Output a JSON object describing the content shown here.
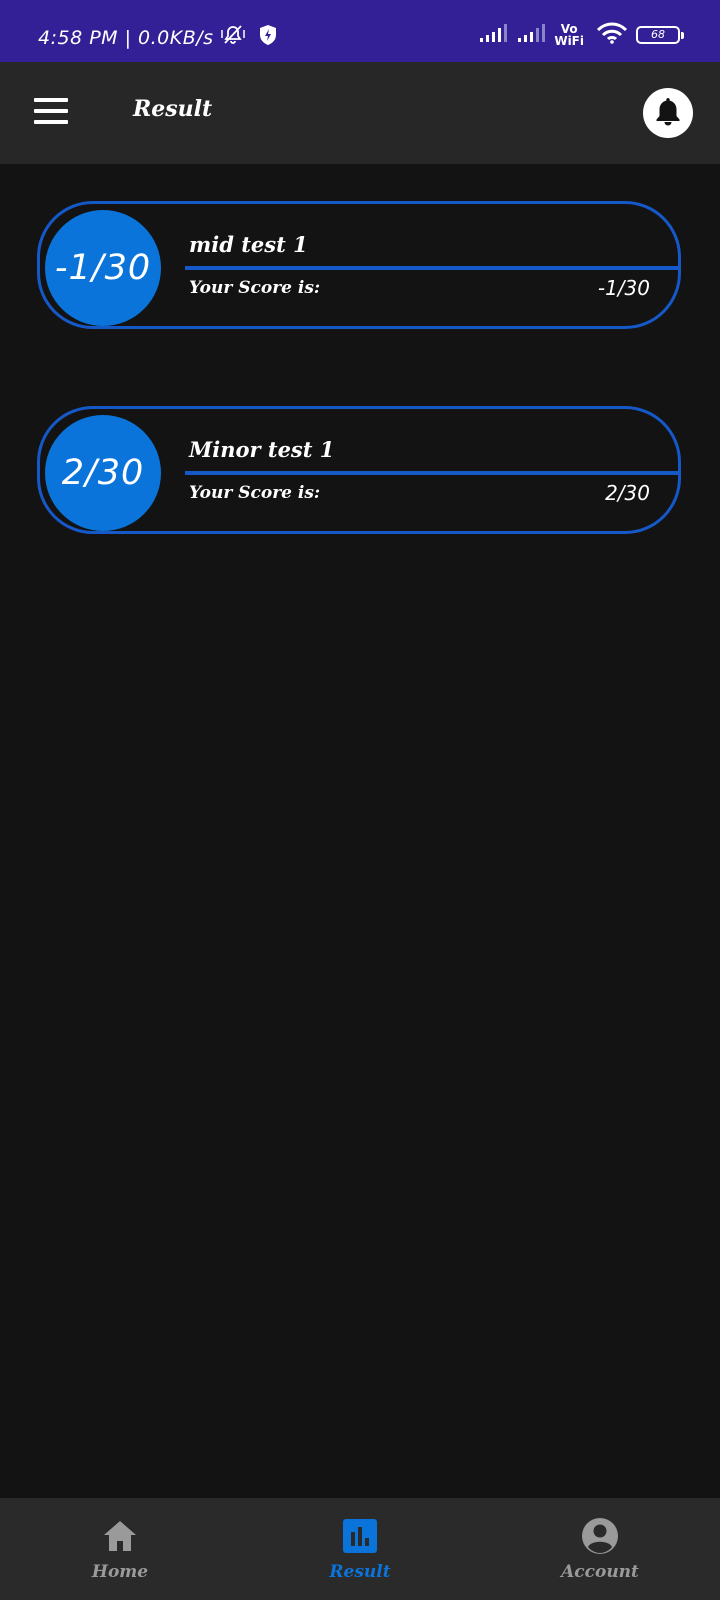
{
  "status_bar": {
    "time_speed": "4:58 PM | 0.0KB/s",
    "vo_label": "Vo",
    "wifi_label": "WiFi",
    "battery": "68"
  },
  "app_bar": {
    "title": "Result"
  },
  "results": [
    {
      "test_name": "mid test 1",
      "score": "-1/30",
      "score_label": "Your Score is:",
      "score_value": "-1/30"
    },
    {
      "test_name": "Minor test 1",
      "score": "2/30",
      "score_label": "Your Score is:",
      "score_value": "2/30"
    }
  ],
  "bottom_nav": {
    "items": [
      {
        "label": "Home",
        "icon": "home-icon"
      },
      {
        "label": "Result",
        "icon": "bar-chart-icon"
      },
      {
        "label": "Account",
        "icon": "account-circle-icon"
      }
    ],
    "active": "Result"
  },
  "colors": {
    "status_bar": "#331f96",
    "app_bar": "#272727",
    "background": "#131313",
    "accent": "#0a74da",
    "card_border": "#1558c8",
    "nav_inactive": "#9a9a9a"
  }
}
